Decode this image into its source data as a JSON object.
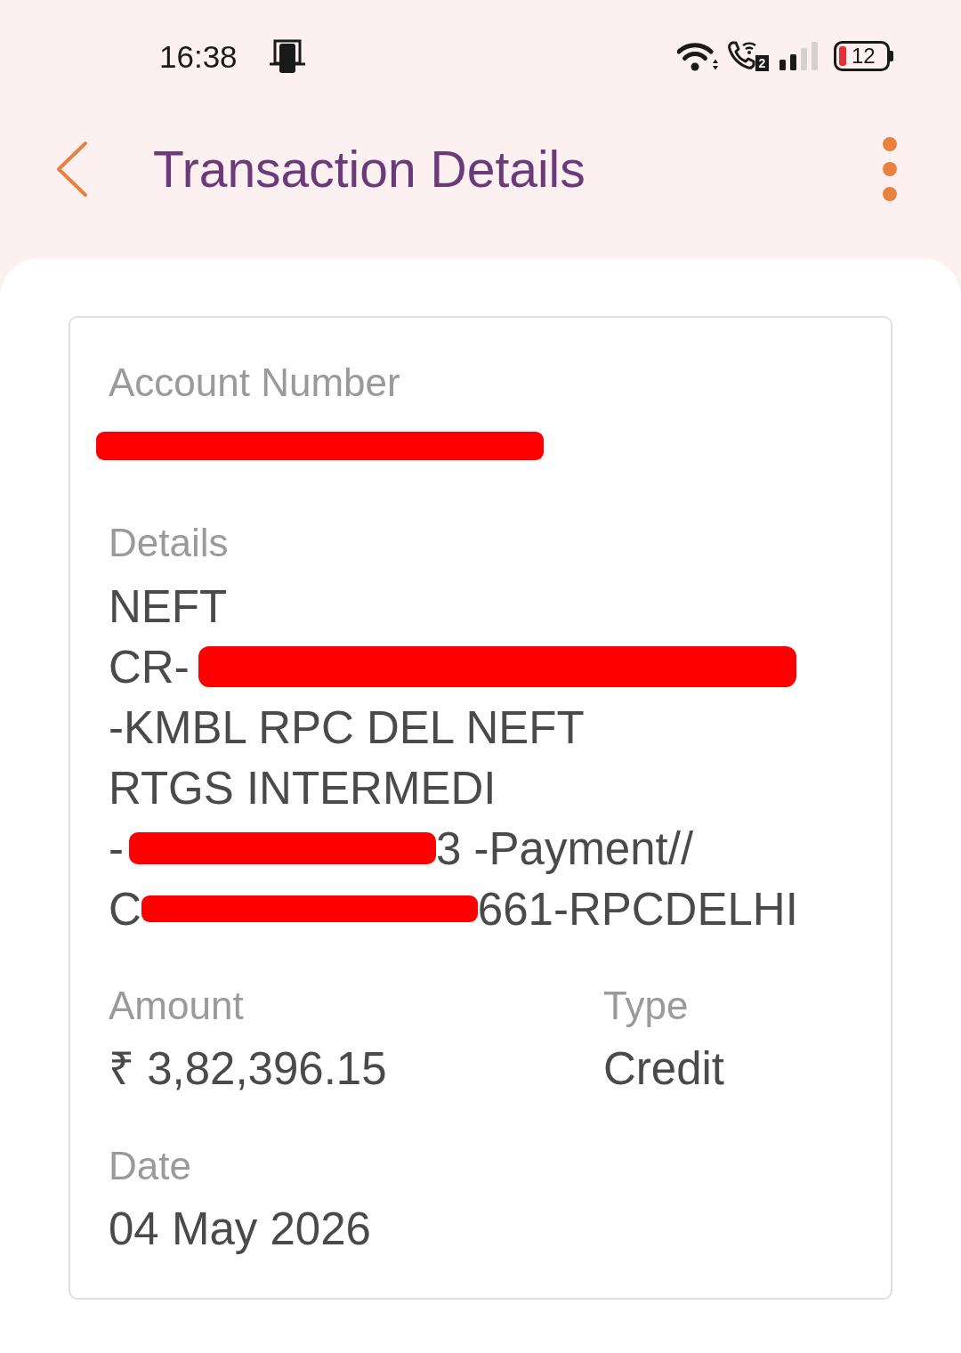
{
  "status_bar": {
    "time": "16:38",
    "sim_badge": "2",
    "battery": "12"
  },
  "header": {
    "title": "Transaction Details"
  },
  "card": {
    "account_number": {
      "label": "Account Number",
      "segments": [
        {
          "kind": "redaction"
        }
      ]
    },
    "details": {
      "label": "Details",
      "lines": [
        {
          "segments": [
            {
              "kind": "text",
              "text": "NEFT"
            }
          ]
        },
        {
          "segments": [
            {
              "kind": "text",
              "text": "CR-"
            },
            {
              "kind": "redaction"
            }
          ]
        },
        {
          "segments": [
            {
              "kind": "text",
              "text": "-KMBL RPC DEL NEFT"
            }
          ]
        },
        {
          "segments": [
            {
              "kind": "text",
              "text": "RTGS INTERMEDI"
            }
          ]
        },
        {
          "segments": [
            {
              "kind": "text",
              "text": "-"
            },
            {
              "kind": "redaction"
            },
            {
              "kind": "text",
              "text": "3 -Payment//"
            }
          ]
        },
        {
          "segments": [
            {
              "kind": "text",
              "text": "C"
            },
            {
              "kind": "redaction"
            },
            {
              "kind": "text",
              "text": "661-RPCDELHI"
            }
          ]
        }
      ]
    },
    "amount": {
      "label": "Amount",
      "value": "₹ 3,82,396.15"
    },
    "type": {
      "label": "Type",
      "value": "Credit"
    },
    "date": {
      "label": "Date",
      "value": "04 May 2026"
    }
  }
}
